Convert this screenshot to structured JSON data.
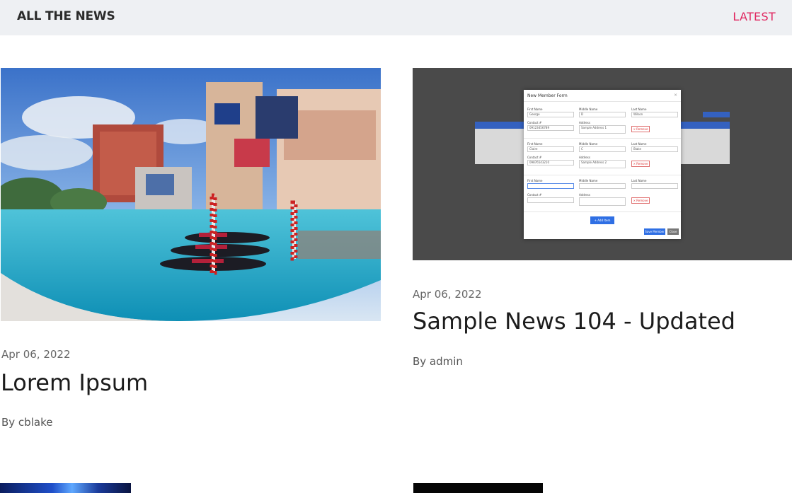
{
  "header": {
    "title": "ALL THE NEWS",
    "latest_label": "LATEST"
  },
  "articles": [
    {
      "date": "Apr 06, 2022",
      "title": "Lorem Ipsum",
      "author": "By cblake",
      "image": "venice-gondola-photo"
    },
    {
      "date": "Apr 06, 2022",
      "title": "Sample News 104 - Updated",
      "author": "By admin",
      "image": "member-form-screenshot"
    }
  ],
  "form_thumbnail": {
    "window_title": "New Member Form",
    "close": "×",
    "rows": [
      {
        "first_label": "First Name",
        "first": "George",
        "middle_label": "Middle Name",
        "middle": "D",
        "last_label": "Last Name",
        "last": "Wilson",
        "contact_label": "Contact #",
        "contact": "09123456789",
        "address_label": "Address",
        "address": "Sample Address 1",
        "remove": "× Remove"
      },
      {
        "first_label": "First Name",
        "first": "Claire",
        "middle_label": "Middle Name",
        "middle": "C",
        "last_label": "Last Name",
        "last": "Blake",
        "contact_label": "Contact #",
        "contact": "09876543210",
        "address_label": "Address",
        "address": "Sample Address 2",
        "remove": "× Remove"
      },
      {
        "first_label": "First Name",
        "first": "",
        "middle_label": "Middle Name",
        "middle": "",
        "last_label": "Last Name",
        "last": "",
        "contact_label": "Contact #",
        "contact": "",
        "address_label": "Address",
        "address": "",
        "remove": "× Remove"
      }
    ],
    "add_item": "+ Add Item",
    "save": "Save Member",
    "close_button": "Close"
  },
  "colors": {
    "accent": "#e0245e",
    "header_bg": "#eef0f3",
    "form_primary": "#2f6fe4"
  }
}
